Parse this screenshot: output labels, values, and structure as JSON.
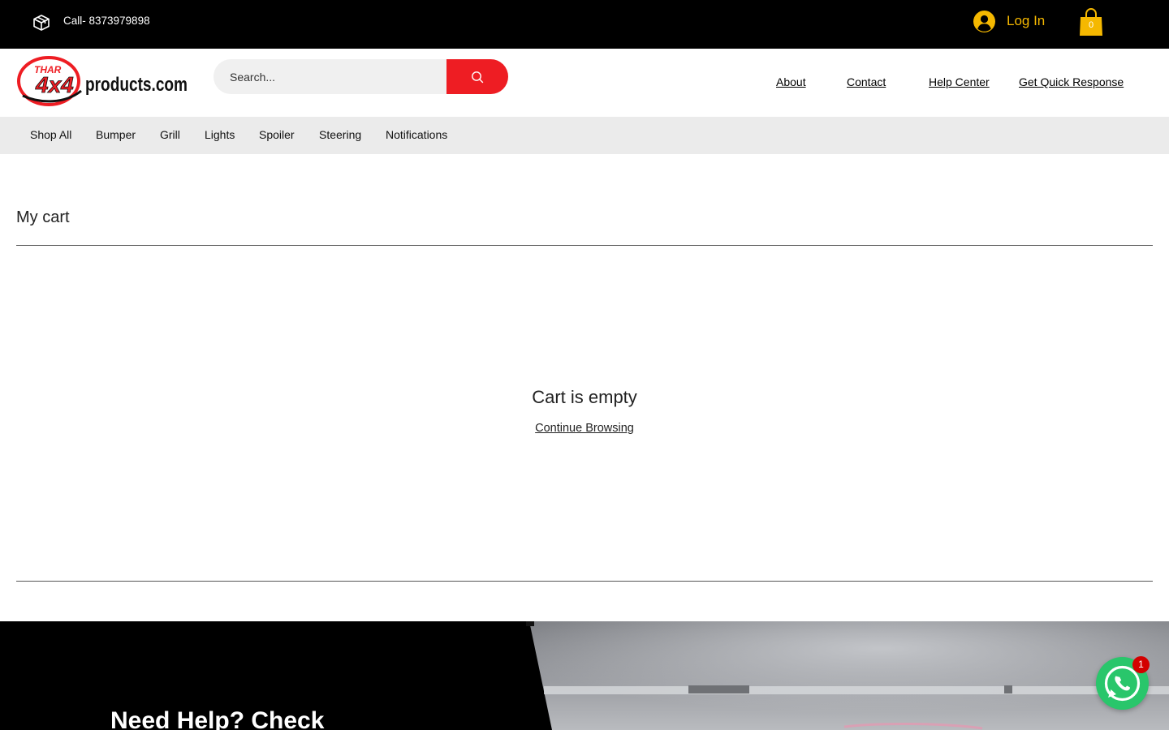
{
  "topbar": {
    "call_text": "Call- 8373979898",
    "login_label": "Log In",
    "cart_count": "0",
    "login_color": "#f5b800"
  },
  "header": {
    "logo": {
      "brand_top": "THAR",
      "brand_main": "4x4",
      "brand_rest": "products.com"
    },
    "search_placeholder": "Search...",
    "nav": [
      "About",
      "Contact",
      "Help Center",
      "Get Quick Response"
    ],
    "accent_color": "#ee1d23"
  },
  "categories": [
    "Shop All",
    "Bumper",
    "Grill",
    "Lights",
    "Spoiler",
    "Steering",
    "Notifications"
  ],
  "cart": {
    "title": "My cart",
    "empty_title": "Cart is empty",
    "continue_label": "Continue Browsing"
  },
  "footer": {
    "help_heading": "Need Help? Check"
  },
  "chat_widget": {
    "icon": "whatsapp-icon",
    "badge": "1",
    "color": "#29c66b"
  }
}
